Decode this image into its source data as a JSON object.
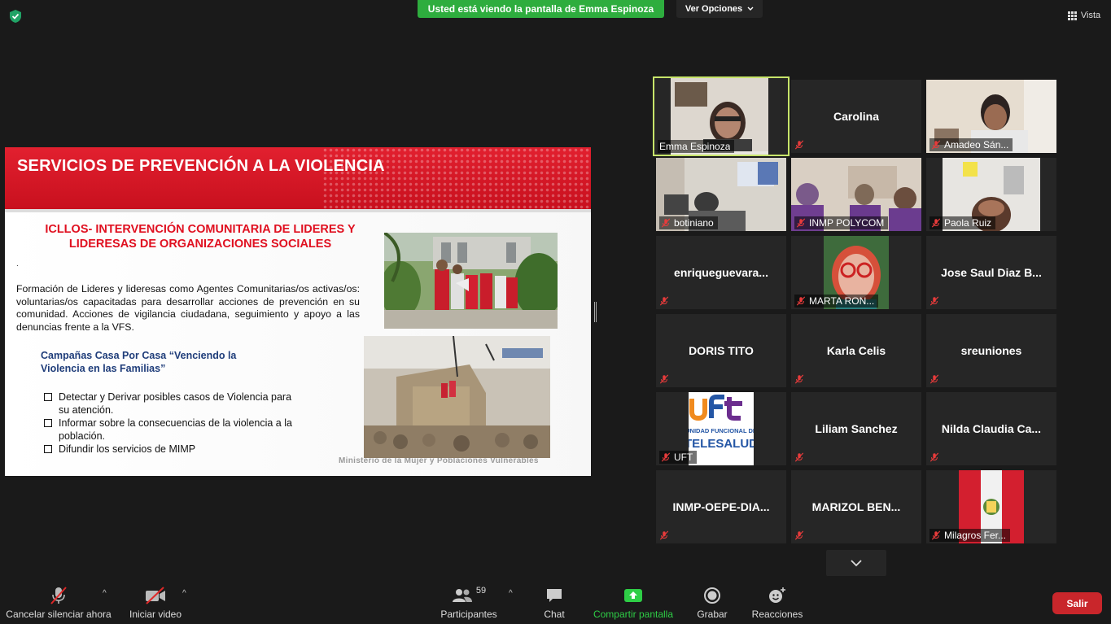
{
  "window": {
    "share_banner": "Usted está viendo la pantalla de Emma Espinoza",
    "view_options": "Ver Opciones",
    "view_button": "Vista"
  },
  "slide": {
    "title": "SERVICIOS DE PREVENCIÓN A LA VIOLENCIA",
    "subtitle": "ICLLOS- INTERVENCIÓN COMUNITARIA DE LIDERES Y LIDERESAS DE ORGANIZACIONES SOCIALES",
    "dot": ".",
    "paragraph": "Formación de Lideres y lideresas como Agentes Comunitarias/os activas/os: voluntarias/os capacitadas para desarrollar acciones de prevención en su comunidad. Acciones de vigilancia ciudadana, seguimiento y apoyo a las denuncias frente a la VFS.",
    "campaign": "Campañas Casa Por Casa “Venciendo la Violencia en las Familias”",
    "bullets": [
      "Detectar  y Derivar posibles casos de Violencia para su atención.",
      "Informar sobre la consecuencias de la violencia a la población.",
      "Difundir los servicios de MIMP"
    ],
    "footer": "Ministerio de la Mujer y Poblaciones Vulnerables"
  },
  "participants_gallery": [
    {
      "name": "Emma Espinoza",
      "video": true
    },
    {
      "name": "Carolina",
      "video": false
    },
    {
      "name": "Amadeo Sán...",
      "video": true
    },
    {
      "name": "botiniano",
      "video": true
    },
    {
      "name": "INMP POLYCOM",
      "video": true
    },
    {
      "name": "Paola Ruiz",
      "video": true
    },
    {
      "name": "enriqueguevara...",
      "video": false
    },
    {
      "name": "MARTA RON...",
      "video": true
    },
    {
      "name": "Jose Saul Diaz B...",
      "video": false
    },
    {
      "name": "DORIS TITO",
      "video": false
    },
    {
      "name": "Karla Celis",
      "video": false
    },
    {
      "name": "sreuniones",
      "video": false
    },
    {
      "name": "UFT",
      "video": true
    },
    {
      "name": "Liliam Sanchez",
      "video": false
    },
    {
      "name": "Nilda  Claudia  Ca...",
      "video": false
    },
    {
      "name": "INMP-OEPE-DIA...",
      "video": false
    },
    {
      "name": "MARIZOL  BEN...",
      "video": false
    },
    {
      "name": "Milagros Fer...",
      "video": true
    }
  ],
  "uft_logo": {
    "line1": "uft",
    "line2": "UNIDAD FUNCIONAL DE",
    "line3": "TELESALUD"
  },
  "toolbar": {
    "unmute": "Cancelar silenciar ahora",
    "start_video": "Iniciar video",
    "participants": "Participantes",
    "participants_count": "59",
    "chat": "Chat",
    "share_screen": "Compartir pantalla",
    "record": "Grabar",
    "reactions": "Reacciones",
    "leave": "Salir"
  },
  "colors": {
    "share_green": "#2ead3e",
    "leave_red": "#c9262b",
    "slide_red": "#e2202f",
    "active_speaker": "#c7e46a"
  }
}
